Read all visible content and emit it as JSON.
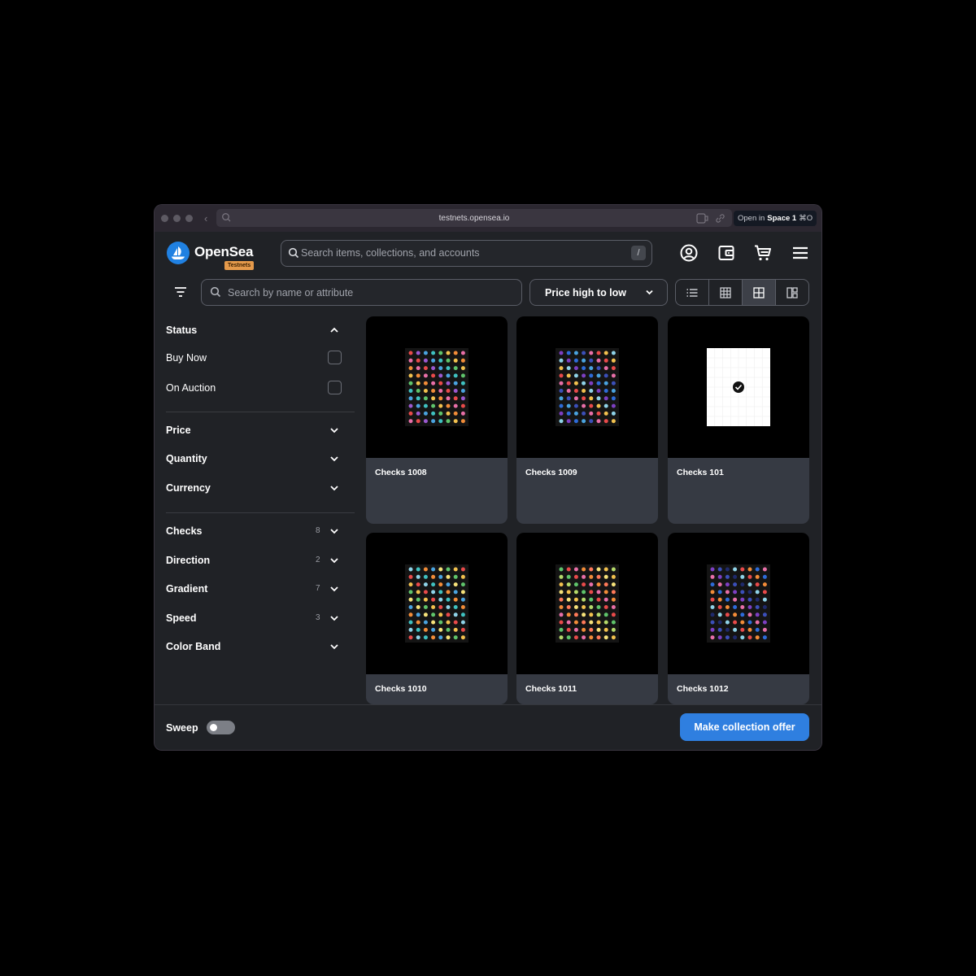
{
  "browser": {
    "url": "testnets.opensea.io",
    "open_in_prefix": "Open in",
    "space_name": "Space 1",
    "shortcut": "⌘O"
  },
  "header": {
    "brand": "OpenSea",
    "network_badge": "Testnets",
    "search_placeholder": "Search items, collections, and accounts",
    "search_shortcut": "/",
    "icons": [
      "profile-icon",
      "wallet-icon",
      "cart-icon",
      "menu-icon"
    ]
  },
  "toolbar": {
    "attribute_search_placeholder": "Search by name or attribute",
    "sort_label": "Price high to low",
    "view_modes": [
      "list-view-icon",
      "grid-small-icon",
      "grid-large-icon",
      "gallery-view-icon"
    ],
    "active_view": "grid-large-icon"
  },
  "sidebar": {
    "status": {
      "title": "Status",
      "options": [
        {
          "label": "Buy Now",
          "checked": false
        },
        {
          "label": "On Auction",
          "checked": false
        }
      ]
    },
    "filters": [
      {
        "label": "Price"
      },
      {
        "label": "Quantity"
      },
      {
        "label": "Currency"
      }
    ],
    "traits": [
      {
        "label": "Checks",
        "count": "8"
      },
      {
        "label": "Direction",
        "count": "2"
      },
      {
        "label": "Gradient",
        "count": "7"
      },
      {
        "label": "Speed",
        "count": "3"
      },
      {
        "label": "Color Band",
        "count": ""
      }
    ]
  },
  "items": [
    {
      "name": "Checks 1008",
      "art": "dots-a"
    },
    {
      "name": "Checks 1009",
      "art": "dots-b"
    },
    {
      "name": "Checks 101",
      "art": "single-check"
    },
    {
      "name": "Checks 1010",
      "art": "dots-c"
    },
    {
      "name": "Checks 1011",
      "art": "dots-d"
    },
    {
      "name": "Checks 1012",
      "art": "dots-e"
    }
  ],
  "footer": {
    "sweep_label": "Sweep",
    "sweep_enabled": false,
    "offer_button": "Make collection offer"
  },
  "colors": {
    "accent": "#2f7fe0",
    "badge": "#e59a4b",
    "background": "#202226",
    "card": "#363a43"
  }
}
